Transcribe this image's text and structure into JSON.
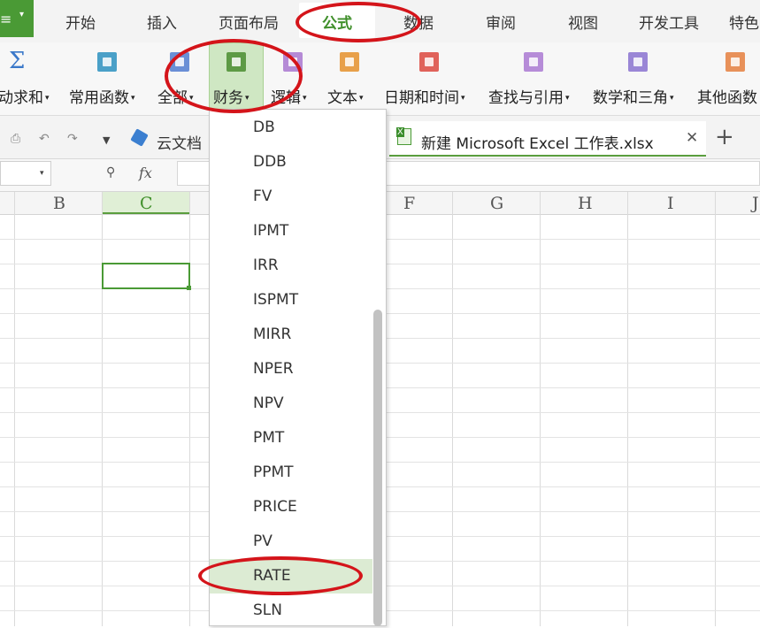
{
  "app_menu": {
    "glyph": "≡",
    "caret": "▾"
  },
  "tabs": [
    "开始",
    "插入",
    "页面布局",
    "公式",
    "数据",
    "审阅",
    "视图",
    "开发工具",
    "特色"
  ],
  "active_tab": "公式",
  "ribbon": {
    "items": [
      {
        "label": "动求和",
        "color": "#3a78c9",
        "icon": "sigma-icon"
      },
      {
        "label": "常用函数",
        "color": "#4aa0c8",
        "icon": "star-book-icon"
      },
      {
        "label": "全部",
        "color": "#6a8fd6",
        "icon": "list-book-icon"
      },
      {
        "label": "财务",
        "color": "#5d9a45",
        "icon": "finance-book-icon"
      },
      {
        "label": "逻辑",
        "color": "#b58ad6",
        "icon": "logic-book-icon"
      },
      {
        "label": "文本",
        "color": "#e8a04a",
        "icon": "text-book-icon"
      },
      {
        "label": "日期和时间",
        "color": "#e0625a",
        "icon": "clock-book-icon"
      },
      {
        "label": "查找与引用",
        "color": "#b68cd8",
        "icon": "search-book-icon"
      },
      {
        "label": "数学和三角",
        "color": "#9a86d6",
        "icon": "theta-book-icon"
      },
      {
        "label": "其他函数",
        "color": "#e8915a",
        "icon": "more-book-icon"
      }
    ],
    "dropdown_glyph": "▾"
  },
  "quick_access": {
    "cloud_label": "云文档"
  },
  "document_tab": {
    "title": "新建 Microsoft Excel 工作表.xlsx",
    "close": "✕",
    "new_tab": "+"
  },
  "formula_bar": {
    "fx": "fx",
    "namebox_caret": "▾",
    "zoom": "⚲"
  },
  "columns": [
    "B",
    "C",
    "F",
    "G",
    "H",
    "I",
    "J"
  ],
  "selected_column": "C",
  "finance_menu": {
    "items": [
      "DB",
      "DDB",
      "FV",
      "IPMT",
      "IRR",
      "ISPMT",
      "MIRR",
      "NPER",
      "NPV",
      "PMT",
      "PPMT",
      "PRICE",
      "PV",
      "RATE",
      "SLN"
    ],
    "highlighted": "RATE"
  },
  "colors": {
    "accent": "#4a9a35",
    "annotation": "#d4141a"
  }
}
